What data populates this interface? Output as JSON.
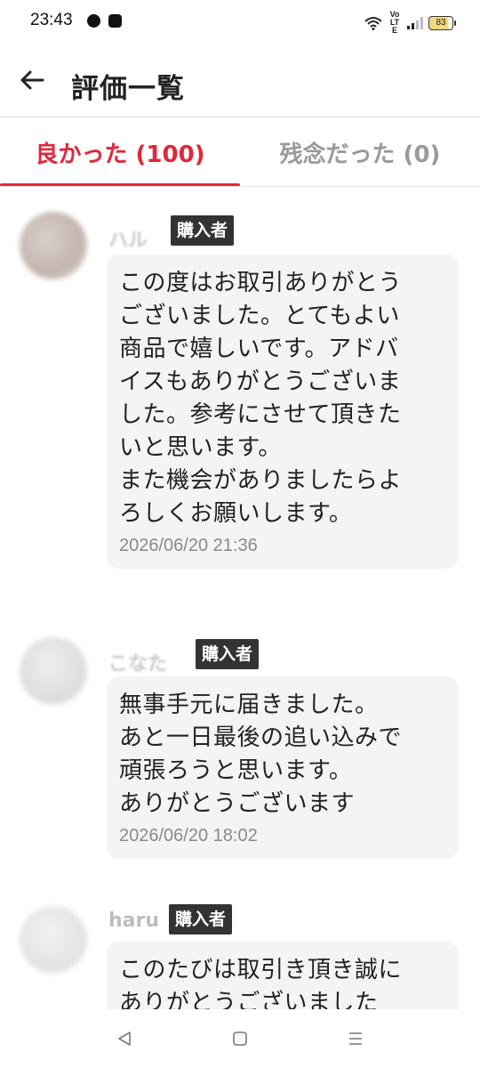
{
  "status_bar": {
    "time": "23:43",
    "network_label": "Vo LTE",
    "battery_level": "83"
  },
  "header": {
    "title": "評価一覧"
  },
  "tabs": [
    {
      "label": "良かった (100)",
      "active": true
    },
    {
      "label": "残念だった (0)",
      "active": false
    }
  ],
  "colors": {
    "accent": "#e0283a",
    "badge_bg": "#333333",
    "bubble_bg": "#f4f4f4",
    "date_text": "#8a8a8a"
  },
  "reviews": [
    {
      "reviewer": "ハル",
      "badge": "購入者",
      "comment": "この度はお取引ありがとう\nございました。とてもよい\n商品で嬉しいです。アドバ\nイスもありがとうございま\nした。参考にさせて頂きた\nいと思います。\nまた機会がありましたらよ\nろしくお願いします。",
      "date": "2026/06/20 21:36"
    },
    {
      "reviewer": "こなた",
      "badge": "購入者",
      "comment": "無事手元に届きました。\nあと一日最後の追い込みで\n頑張ろうと思います。\nありがとうございます",
      "date": "2026/06/20 18:02"
    },
    {
      "reviewer": "haru",
      "badge": "購入者",
      "comment": "このたびは取引き頂き誠に\nありがとうございました",
      "date": ""
    }
  ],
  "nav_icons": [
    "back-triangle-icon",
    "home-square-icon",
    "menu-lines-icon"
  ]
}
